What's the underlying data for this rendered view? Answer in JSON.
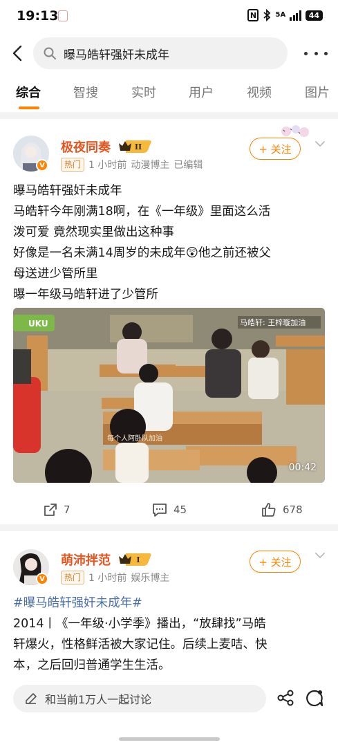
{
  "status_bar": {
    "time": "19:13",
    "network": "5A",
    "battery": "44"
  },
  "search": {
    "query": "曝马皓轩强奸未成年"
  },
  "tabs": [
    {
      "label": "综合",
      "active": true
    },
    {
      "label": "智搜"
    },
    {
      "label": "实时"
    },
    {
      "label": "用户"
    },
    {
      "label": "视频"
    },
    {
      "label": "图片"
    }
  ],
  "posts": [
    {
      "username": "极夜同奏",
      "level_badge": "II",
      "hot_tag": "热门",
      "time": "1 小时前",
      "role": "动漫博主",
      "edited": "已编辑",
      "follow_label": "+ 关注",
      "lines": [
        "曝马皓轩强奸未成年",
        "马皓轩今年刚满18啊，在《一年级》里面这么活",
        "泼可爱 竟然现实里做出这种事",
        "好像是一名未满14周岁的未成年😲他之前还被父",
        "母送进少管所里",
        "曝一年级马皓轩进了少管所"
      ],
      "video": {
        "watermark_left": "UKU",
        "caption_right": "马皓轩: 王梓璇加油",
        "desk_label": "每个人阿卧队加油",
        "duration": "00:42"
      },
      "reposts": "7",
      "comments": "45",
      "likes": "678"
    },
    {
      "username": "萌沛拌范",
      "level_badge": "I",
      "hot_tag": "热门",
      "time": "1 小时前",
      "role": "娱乐博主",
      "follow_label": "+ 关注",
      "hashtag": "#曝马皓轩强奸未成年#",
      "lines": [
        "2014丨《一年级·小学季》播出，“放肆找”马皓",
        "轩爆火，性格鲜活被大家记住。后续上麦咭、快",
        "本，之后回归普通学生生活。"
      ]
    }
  ],
  "bottom_bar": {
    "comment_placeholder": "和当前1万人一起讨论"
  },
  "colors": {
    "accent": "#ff8200",
    "username": "#e8541e",
    "hashtag": "#4a6fa5"
  }
}
